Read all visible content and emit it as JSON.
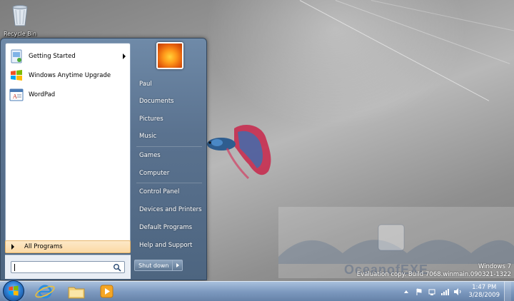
{
  "desktop": {
    "icons": [
      {
        "label": "Recycle Bin",
        "icon": "recycle-bin-icon"
      }
    ],
    "watermark_text": "OceanofEXE",
    "build_info": {
      "line1": "Windows 7",
      "line2": "Evaluation copy. Build 7068.winmain.090321-1322"
    }
  },
  "start_menu": {
    "pinned_programs": [
      {
        "label": "Getting Started",
        "icon": "getting-started-icon",
        "has_submenu": true
      },
      {
        "label": "Windows Anytime Upgrade",
        "icon": "windows-flag-icon",
        "has_submenu": false
      },
      {
        "label": "WordPad",
        "icon": "wordpad-icon",
        "has_submenu": false
      }
    ],
    "all_programs_label": "All Programs",
    "search": {
      "value": "",
      "placeholder": ""
    },
    "user_picture": "flower-avatar",
    "right_items": [
      {
        "label": "Paul"
      },
      {
        "label": "Documents"
      },
      {
        "label": "Pictures"
      },
      {
        "label": "Music"
      },
      {
        "label": "Games"
      },
      {
        "label": "Computer"
      },
      {
        "label": "Control Panel"
      },
      {
        "label": "Devices and Printers"
      },
      {
        "label": "Default Programs"
      },
      {
        "label": "Help and Support"
      }
    ],
    "shutdown_label": "Shut down"
  },
  "taskbar": {
    "pinned": [
      {
        "name": "internet-explorer-icon"
      },
      {
        "name": "windows-explorer-icon"
      },
      {
        "name": "media-player-icon"
      }
    ],
    "tray_icons": [
      "show-hidden-icons",
      "action-center-icon",
      "network-icon",
      "signal-icon",
      "volume-icon"
    ],
    "clock": {
      "time": "1:47 PM",
      "date": "3/28/2009"
    }
  },
  "colors": {
    "start_menu_bg": "#5a728f",
    "taskbar_bg": "#7d9bc3",
    "all_programs_highlight": "#fbd9a4"
  }
}
